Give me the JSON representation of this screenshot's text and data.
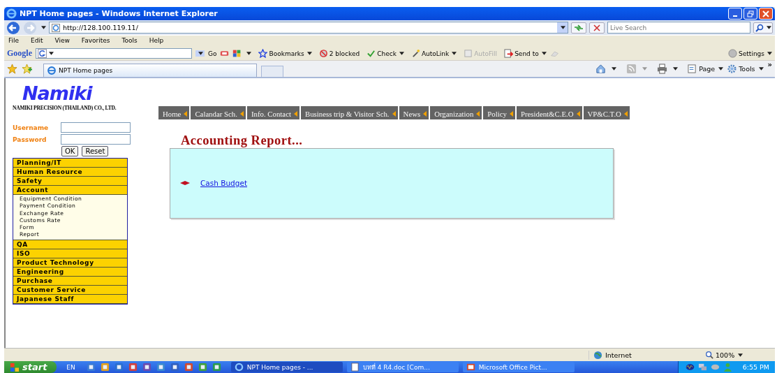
{
  "window": {
    "title": "NPT Home pages - Windows Internet Explorer"
  },
  "address_bar": {
    "url": "http://128.100.119.11/",
    "search_placeholder": "Live Search"
  },
  "menu": [
    "File",
    "Edit",
    "View",
    "Favorites",
    "Tools",
    "Help"
  ],
  "google_toolbar": {
    "logo": "Google",
    "go": "Go",
    "items": [
      {
        "label": "Bookmarks",
        "disabled": false,
        "dropdown": true
      },
      {
        "label": "2 blocked",
        "disabled": false,
        "dropdown": false
      },
      {
        "label": "Check",
        "disabled": false,
        "dropdown": true
      },
      {
        "label": "AutoLink",
        "disabled": false,
        "dropdown": true
      },
      {
        "label": "AutoFill",
        "disabled": true,
        "dropdown": false
      },
      {
        "label": "Send to",
        "disabled": false,
        "dropdown": true
      }
    ],
    "settings": "Settings"
  },
  "tab": {
    "label": "NPT Home pages"
  },
  "command_bar": [
    "Page",
    "Tools"
  ],
  "command_more": "»",
  "page": {
    "logo": "Namiki",
    "company": "NAMIKI PRECISION (THAILAND) CO., LTD.",
    "login": {
      "username_label": "Username",
      "password_label": "Password",
      "buttons": [
        "OK",
        "Reset"
      ]
    },
    "sidebar": [
      {
        "label": "Planning/IT"
      },
      {
        "label": "Human Resource"
      },
      {
        "label": "Safety"
      },
      {
        "label": "Account",
        "children": [
          "Equipment Condition",
          "Payment Condition",
          "Exchange Rate",
          "Customs Rate",
          "Form",
          "Report"
        ]
      },
      {
        "label": "QA"
      },
      {
        "label": "ISO"
      },
      {
        "label": "Product Technology"
      },
      {
        "label": "Engineering"
      },
      {
        "label": "Purchase"
      },
      {
        "label": "Customer Service"
      },
      {
        "label": "Japanese Staff"
      }
    ],
    "top_nav": [
      "Home",
      "Calandar Sch.",
      "Info. Contact",
      "Business trip & Visitor Sch.",
      "News",
      "Organization",
      "Policy",
      "President&C.E.O",
      "VP&C.T.O"
    ],
    "heading": "Accounting Report...",
    "links": [
      "Cash Budget"
    ]
  },
  "status_bar": {
    "zone": "Internet",
    "zoom": "100%"
  },
  "taskbar": {
    "start": "start",
    "language": "EN",
    "tasks": [
      {
        "label": "NPT Home pages - ...",
        "selected": true
      },
      {
        "label": "บทที่ 4 R4.doc [Com...",
        "selected": false
      },
      {
        "label": "Microsoft Office Pict...",
        "selected": false
      }
    ],
    "clock": "6:55 PM"
  }
}
